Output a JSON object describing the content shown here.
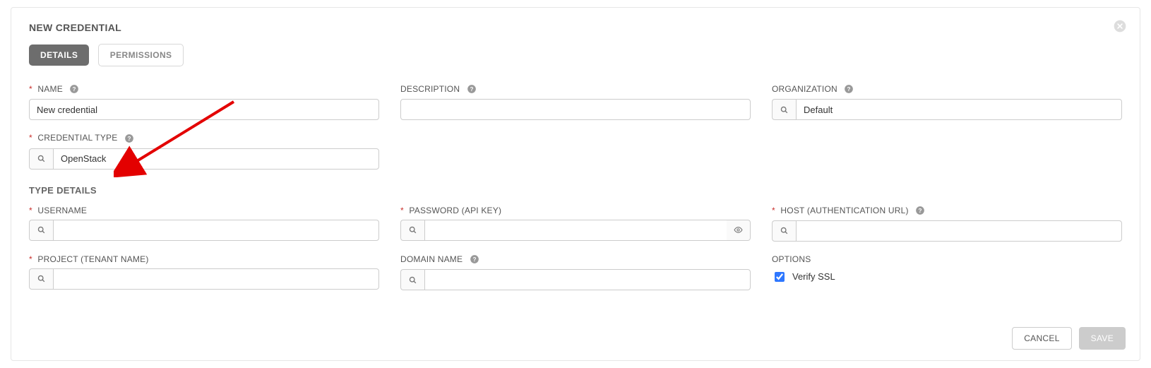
{
  "header": {
    "title": "NEW CREDENTIAL"
  },
  "tabs": {
    "details": "DETAILS",
    "permissions": "PERMISSIONS"
  },
  "fields": {
    "name": {
      "label": "NAME",
      "value": "New credential"
    },
    "description": {
      "label": "DESCRIPTION",
      "value": ""
    },
    "organization": {
      "label": "ORGANIZATION",
      "value": "Default"
    },
    "credential_type": {
      "label": "CREDENTIAL TYPE",
      "value": "OpenStack"
    }
  },
  "section": {
    "type_details": "TYPE DETAILS"
  },
  "type_fields": {
    "username": {
      "label": "USERNAME",
      "value": ""
    },
    "password": {
      "label": "PASSWORD (API KEY)",
      "value": ""
    },
    "host": {
      "label": "HOST (AUTHENTICATION URL)",
      "value": ""
    },
    "project": {
      "label": "PROJECT (TENANT NAME)",
      "value": ""
    },
    "domain": {
      "label": "DOMAIN NAME",
      "value": ""
    },
    "options_label": "OPTIONS",
    "verify_ssl": {
      "label": "Verify SSL",
      "checked": true
    }
  },
  "actions": {
    "cancel": "CANCEL",
    "save": "SAVE"
  }
}
